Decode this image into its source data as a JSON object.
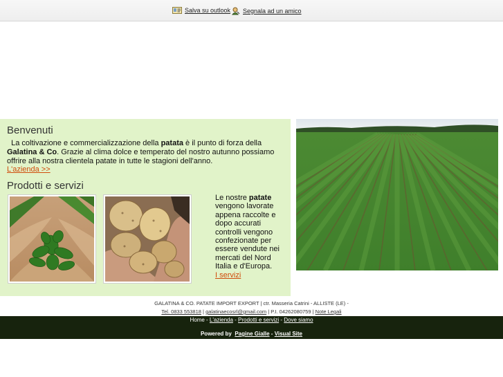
{
  "toolbar": {
    "save_outlook": "Salva su outlook",
    "report_friend": "Segnala ad un amico"
  },
  "welcome": {
    "title": "Benvenuti",
    "t1": "La coltivazione e commercializzazione della ",
    "b1": "patata",
    "t2": " è il punto di forza della ",
    "b2": "Galatina & Co",
    "t3": ". Grazie al clima dolce e temperato del nostro autunno possiamo offrire alla nostra clientela patate in tutte le stagioni dell'anno.",
    "link": "L'azienda >>"
  },
  "products": {
    "title": "Prodotti e servizi",
    "t1": "Le nostre ",
    "b1": "patate",
    "t2": " vengono lavorate appena raccolte e dopo accurati controlli vengono confezionate per essere vendute nei mercati del Nord Italia e d'Europa.",
    "link": "I servizi"
  },
  "footer": {
    "address": "GALATINA & CO. PATATE IMPORT EXPORT | ctr. Masseria Catrini - ALLISTE (LE) -",
    "phone": "Tel. 0833 553818",
    "sep1": " | ",
    "email": "galatinaecosrl@gmail.com",
    "piva": " | P.I. 04262080759 | ",
    "legal": "Note Legali",
    "nav": [
      "Home",
      "L'azienda",
      "Prodotti e servizi",
      "Dove siamo"
    ],
    "nav_sep": " - ",
    "powered_by": "Powered by",
    "pagine_gialle": "Pagine Gialle",
    "dash": " - ",
    "visual_site": "Visual Site"
  }
}
